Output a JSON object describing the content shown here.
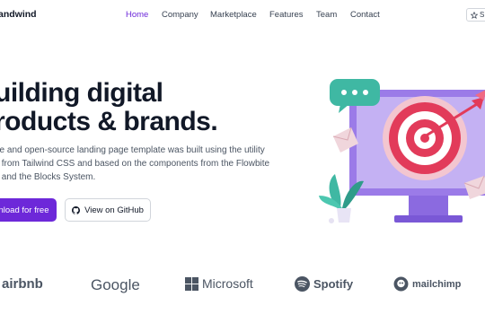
{
  "nav": {
    "brand": "andwind",
    "links": [
      {
        "label": "Home",
        "active": true
      },
      {
        "label": "Company"
      },
      {
        "label": "Marketplace"
      },
      {
        "label": "Features"
      },
      {
        "label": "Team"
      },
      {
        "label": "Contact"
      }
    ],
    "star_label": "S",
    "star_icon": "star-icon"
  },
  "hero": {
    "title_line1": "uilding digital",
    "title_line2": "roducts & brands.",
    "desc_line1": "ee and open-source landing page template was built using the utility",
    "desc_line2": "s from Tailwind CSS and based on the components from the Flowbite",
    "desc_line3": "y and the Blocks System.",
    "primary_button": "nload for free",
    "secondary_button": "View on GitHub",
    "secondary_icon": "github-icon"
  },
  "logos": {
    "airbnb": "airbnb",
    "google": "Google",
    "microsoft": "Microsoft",
    "spotify": "Spotify",
    "mailchimp": "mailchimp"
  },
  "colors": {
    "accent": "#6d28d9",
    "text": "#111827",
    "muted": "#4b5563",
    "target_red": "#e23b5a",
    "monitor": "#9b7be8"
  }
}
